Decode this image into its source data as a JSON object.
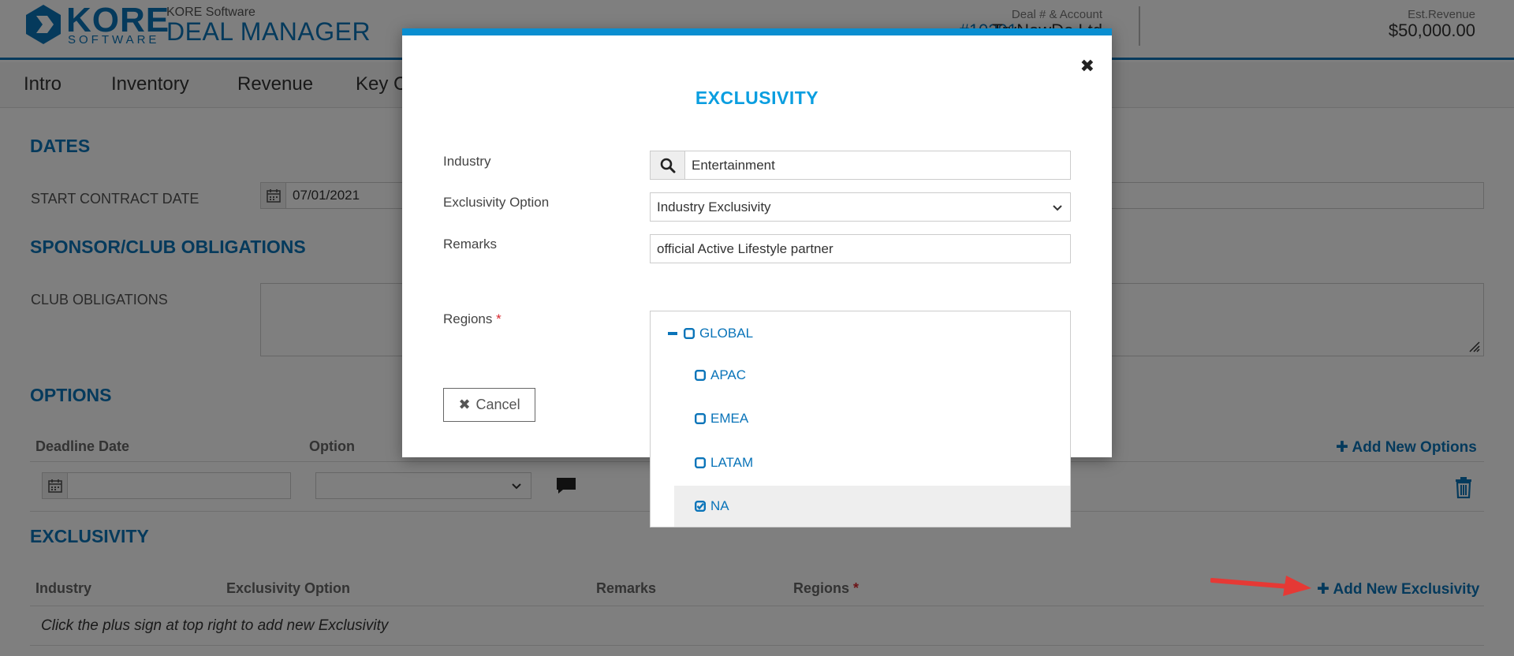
{
  "header": {
    "logo_word": "KORE",
    "logo_sub": "SOFTWARE",
    "app_company": "KORE Software",
    "app_name": "DEAL MANAGER",
    "deal_label": "Deal # & Account",
    "deal_id": "#10291",
    "deal_account": "TryNowDo Ltd",
    "revenue_label": "Est.Revenue",
    "revenue_value": "$50,000.00"
  },
  "nav": {
    "items": [
      "Intro",
      "Inventory",
      "Revenue",
      "Key C"
    ]
  },
  "page": {
    "dates_title": "DATES",
    "start_contract_label": "START CONTRACT DATE",
    "start_contract_value": "07/01/2021",
    "sponsor_title": "SPONSOR/CLUB OBLIGATIONS",
    "club_obligations_label": "CLUB OBLIGATIONS",
    "options_title": "OPTIONS",
    "options_columns": [
      "Deadline Date",
      "Option"
    ],
    "add_new_options": "Add New Options",
    "exclusivity_title": "EXCLUSIVITY",
    "exclusivity_columns": [
      "Industry",
      "Exclusivity Option",
      "Remarks",
      "Regions"
    ],
    "add_new_exclusivity": "Add New Exclusivity",
    "empty_message": "Click the plus sign at top right to add new Exclusivity"
  },
  "modal": {
    "title": "EXCLUSIVITY",
    "close_symbol": "✖",
    "industry_label": "Industry",
    "industry_value": "Entertainment",
    "option_label": "Exclusivity Option",
    "option_value": "Industry Exclusivity",
    "remarks_label": "Remarks",
    "remarks_value": "official Active Lifestyle partner",
    "regions_label": "Regions",
    "required_mark": "*",
    "cancel_label": "Cancel"
  },
  "regions_tree": {
    "root": "GLOBAL",
    "children": [
      {
        "label": "APAC",
        "checked": false
      },
      {
        "label": "EMEA",
        "checked": false
      },
      {
        "label": "LATAM",
        "checked": false
      },
      {
        "label": "NA",
        "checked": true
      }
    ]
  },
  "colors": {
    "brand_blue": "#0a74b9",
    "modal_accent": "#0a8ed0",
    "required_red": "#d9282f",
    "annotation_red": "#e53935"
  }
}
